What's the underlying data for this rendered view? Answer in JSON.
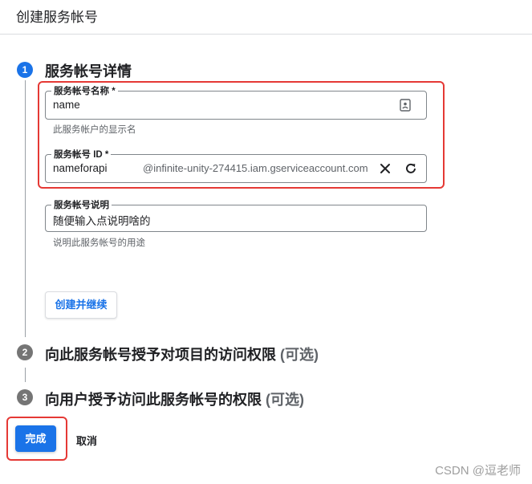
{
  "page": {
    "title": "创建服务帐号"
  },
  "steps": [
    {
      "number": "1",
      "title": "服务帐号详情",
      "optional": ""
    },
    {
      "number": "2",
      "title": "向此服务帐号授予对项目的访问权限",
      "optional": "(可选)"
    },
    {
      "number": "3",
      "title": "向用户授予访问此服务帐号的权限",
      "optional": "(可选)"
    }
  ],
  "form": {
    "name": {
      "label": "服务帐号名称 *",
      "value": "name",
      "hint": "此服务帐户的显示名",
      "icon": "contact-card-icon"
    },
    "id": {
      "label": "服务帐号 ID *",
      "value": "nameforapi",
      "suffix": "@infinite-unity-274415.iam.gserviceaccount.com",
      "clear_icon": "close-icon",
      "refresh_icon": "refresh-icon"
    },
    "description": {
      "label": "服务帐号说明",
      "value": "随便输入点说明啥的",
      "hint": "说明此服务帐号的用途"
    }
  },
  "buttons": {
    "create_continue": "创建并继续",
    "done": "完成",
    "cancel": "取消"
  },
  "watermark": "CSDN @逗老师",
  "colors": {
    "accent": "#1a73e8",
    "highlight": "#e53935",
    "text": "#202124",
    "muted": "#5f6368"
  }
}
